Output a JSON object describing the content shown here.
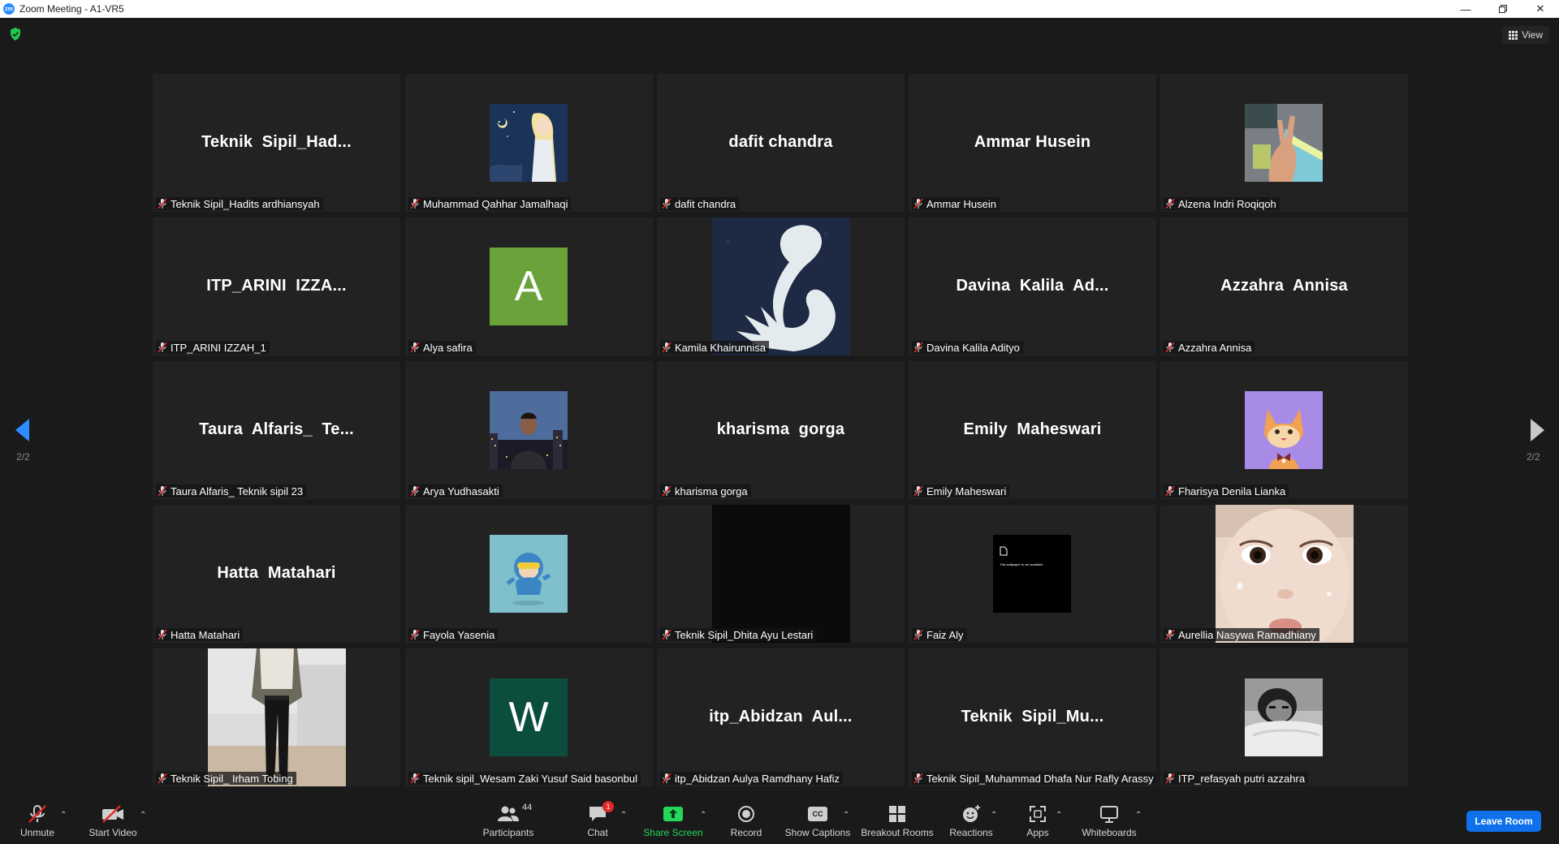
{
  "window": {
    "title": "Zoom Meeting - A1-VR5",
    "logo_text": "zm"
  },
  "view_button": {
    "label": "View"
  },
  "tiles": [
    {
      "display": "Teknik  Sipil_Had...",
      "name": "Teknik Sipil_Hadits ardhiansyah",
      "kind": "text"
    },
    {
      "display": "",
      "name": "Muhammad Qahhar Jamalhaqi",
      "kind": "anime"
    },
    {
      "display": "dafit chandra",
      "name": "dafit chandra",
      "kind": "text"
    },
    {
      "display": "Ammar Husein",
      "name": "Ammar Husein",
      "kind": "text"
    },
    {
      "display": "",
      "name": "Alzena Indri Roqiqoh",
      "kind": "hand"
    },
    {
      "display": "ITP_ARINI  IZZA...",
      "name": "ITP_ARINI IZZAH_1",
      "kind": "text"
    },
    {
      "display": "A",
      "name": "Alya safira",
      "kind": "letter",
      "color": "#6aa33a"
    },
    {
      "display": "",
      "name": "Kamila Khairunnisa",
      "kind": "swan"
    },
    {
      "display": "Davina  Kalila  Ad...",
      "name": "Davina Kalila Adityo",
      "kind": "text"
    },
    {
      "display": "Azzahra  Annisa",
      "name": "Azzahra Annisa",
      "kind": "text"
    },
    {
      "display": "Taura  Alfaris_  Te...",
      "name": "Taura Alfaris_ Teknik sipil 23",
      "kind": "text"
    },
    {
      "display": "",
      "name": "Arya Yudhasakti",
      "kind": "city"
    },
    {
      "display": "kharisma  gorga",
      "name": "kharisma gorga",
      "kind": "text"
    },
    {
      "display": "Emily  Maheswari",
      "name": "Emily Maheswari",
      "kind": "text"
    },
    {
      "display": "",
      "name": "Fharisya Denila Lianka",
      "kind": "cat"
    },
    {
      "display": "Hatta  Matahari",
      "name": "Hatta Matahari",
      "kind": "text"
    },
    {
      "display": "",
      "name": "Fayola Yasenia",
      "kind": "pocoyo"
    },
    {
      "display": "",
      "name": "Teknik Sipil_Dhita Ayu Lestari",
      "kind": "dark"
    },
    {
      "display": "",
      "name": "Faiz Aly",
      "kind": "wallpaper",
      "note": "This wallpaper is not available"
    },
    {
      "display": "",
      "name": "Aurellia Nasywa Ramadhiany",
      "kind": "baby"
    },
    {
      "display": "",
      "name": "Teknik Sipil_ Irham Tobing",
      "kind": "person"
    },
    {
      "display": "W",
      "name": "Teknik sipil_Wesam Zaki Yusuf Said basonbul",
      "kind": "letter",
      "color": "#0b4e3d"
    },
    {
      "display": "itp_Abidzan  Aul...",
      "name": "itp_Abidzan Aulya Ramdhany Hafiz",
      "kind": "text"
    },
    {
      "display": "Teknik  Sipil_Mu...",
      "name": "Teknik Sipil_Muhammad Dhafa Nur Rafly Arassy",
      "kind": "text"
    },
    {
      "display": "",
      "name": "ITP_refasyah putri azzahra",
      "kind": "bw"
    }
  ],
  "pagination": {
    "left": "2/2",
    "right": "2/2"
  },
  "toolbar": {
    "unmute": "Unmute",
    "start_video": "Start Video",
    "participants": "Participants",
    "participants_count": "44",
    "chat": "Chat",
    "chat_badge": "1",
    "share_screen": "Share Screen",
    "record": "Record",
    "show_captions": "Show Captions",
    "captions_icon_text": "CC",
    "breakout_rooms": "Breakout Rooms",
    "reactions": "Reactions",
    "apps": "Apps",
    "whiteboards": "Whiteboards",
    "leave_room": "Leave Room"
  },
  "colors": {
    "share_green": "#23d959",
    "leave_blue": "#0e71eb",
    "muted_red": "#e02828"
  }
}
